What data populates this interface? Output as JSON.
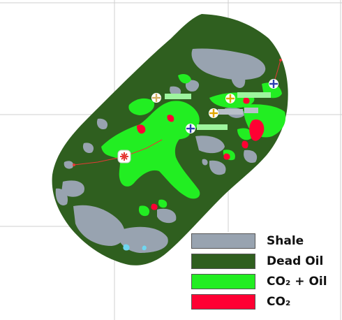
{
  "legend": {
    "items": [
      {
        "key": "shale",
        "label": "Shale",
        "color": "#98a3b0"
      },
      {
        "key": "dead_oil",
        "label": "Dead Oil",
        "color": "#2f5f1f"
      },
      {
        "key": "co2_oil",
        "label": "CO₂ + Oil",
        "color": "#22ee22"
      },
      {
        "key": "co2",
        "label": "CO₂",
        "color": "#ff0033"
      }
    ]
  },
  "colors": {
    "grid_line": "#cfcfcf",
    "well_path": "#e53935",
    "injector_marker": "#e53935",
    "producer_marker": "#2d3fb0",
    "observation_marker": "#e0a800",
    "minor_blue": "#6fd6f0"
  },
  "well_markers": [
    {
      "type": "injector",
      "icon": "asterisk-icon"
    },
    {
      "type": "producer",
      "icon": "crosshair-plus-icon"
    },
    {
      "type": "producer",
      "icon": "crosshair-plus-icon"
    },
    {
      "type": "observation",
      "icon": "crosshair-plus-icon"
    },
    {
      "type": "observation",
      "icon": "crosshair-plus-icon"
    },
    {
      "type": "observation",
      "icon": "crosshair-plus-icon"
    }
  ]
}
